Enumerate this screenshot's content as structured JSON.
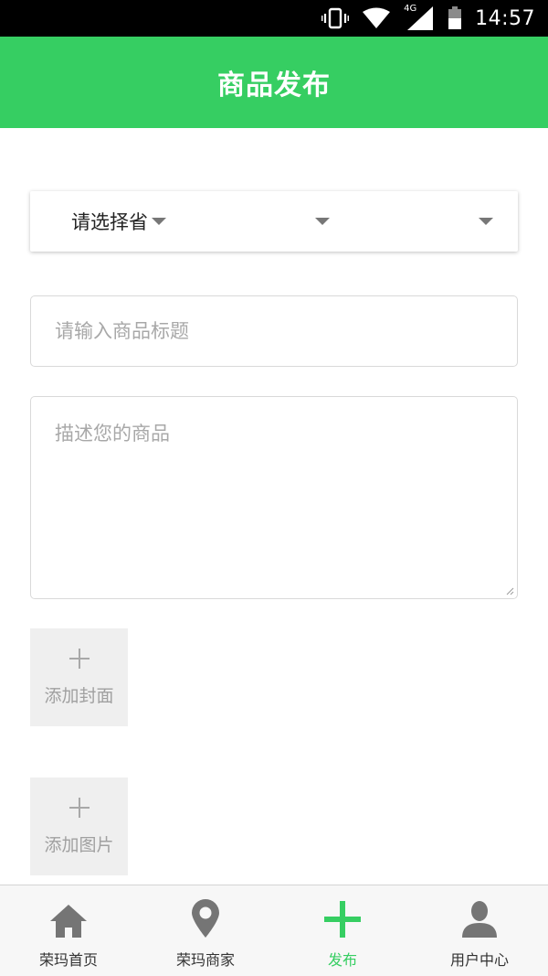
{
  "status_bar": {
    "time": "14:57",
    "network": "4G"
  },
  "header": {
    "title": "商品发布"
  },
  "region": {
    "province_label": "请选择省",
    "city_label": "",
    "district_label": ""
  },
  "form": {
    "title_placeholder": "请输入商品标题",
    "description_placeholder": "描述您的商品",
    "add_cover_label": "添加封面",
    "add_images_label": "添加图片"
  },
  "bottom_nav": {
    "items": [
      {
        "label": "荣玛首页",
        "icon": "home-icon"
      },
      {
        "label": "荣玛商家",
        "icon": "location-pin-icon"
      },
      {
        "label": "发布",
        "icon": "plus-icon",
        "active": true
      },
      {
        "label": "用户中心",
        "icon": "user-icon"
      }
    ]
  },
  "colors": {
    "accent": "#36ce62",
    "nav_icon": "#757575",
    "placeholder": "#a8a8a8"
  }
}
